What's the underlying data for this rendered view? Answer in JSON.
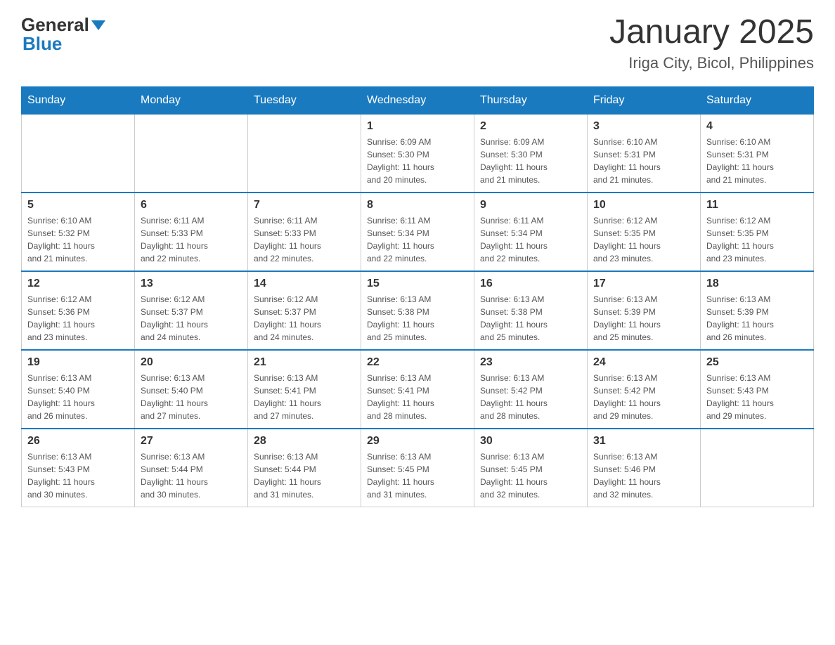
{
  "header": {
    "logo": {
      "general": "General",
      "blue": "Blue"
    },
    "title": "January 2025",
    "location": "Iriga City, Bicol, Philippines"
  },
  "calendar": {
    "days_of_week": [
      "Sunday",
      "Monday",
      "Tuesday",
      "Wednesday",
      "Thursday",
      "Friday",
      "Saturday"
    ],
    "weeks": [
      [
        {
          "day": "",
          "info": ""
        },
        {
          "day": "",
          "info": ""
        },
        {
          "day": "",
          "info": ""
        },
        {
          "day": "1",
          "info": "Sunrise: 6:09 AM\nSunset: 5:30 PM\nDaylight: 11 hours\nand 20 minutes."
        },
        {
          "day": "2",
          "info": "Sunrise: 6:09 AM\nSunset: 5:30 PM\nDaylight: 11 hours\nand 21 minutes."
        },
        {
          "day": "3",
          "info": "Sunrise: 6:10 AM\nSunset: 5:31 PM\nDaylight: 11 hours\nand 21 minutes."
        },
        {
          "day": "4",
          "info": "Sunrise: 6:10 AM\nSunset: 5:31 PM\nDaylight: 11 hours\nand 21 minutes."
        }
      ],
      [
        {
          "day": "5",
          "info": "Sunrise: 6:10 AM\nSunset: 5:32 PM\nDaylight: 11 hours\nand 21 minutes."
        },
        {
          "day": "6",
          "info": "Sunrise: 6:11 AM\nSunset: 5:33 PM\nDaylight: 11 hours\nand 22 minutes."
        },
        {
          "day": "7",
          "info": "Sunrise: 6:11 AM\nSunset: 5:33 PM\nDaylight: 11 hours\nand 22 minutes."
        },
        {
          "day": "8",
          "info": "Sunrise: 6:11 AM\nSunset: 5:34 PM\nDaylight: 11 hours\nand 22 minutes."
        },
        {
          "day": "9",
          "info": "Sunrise: 6:11 AM\nSunset: 5:34 PM\nDaylight: 11 hours\nand 22 minutes."
        },
        {
          "day": "10",
          "info": "Sunrise: 6:12 AM\nSunset: 5:35 PM\nDaylight: 11 hours\nand 23 minutes."
        },
        {
          "day": "11",
          "info": "Sunrise: 6:12 AM\nSunset: 5:35 PM\nDaylight: 11 hours\nand 23 minutes."
        }
      ],
      [
        {
          "day": "12",
          "info": "Sunrise: 6:12 AM\nSunset: 5:36 PM\nDaylight: 11 hours\nand 23 minutes."
        },
        {
          "day": "13",
          "info": "Sunrise: 6:12 AM\nSunset: 5:37 PM\nDaylight: 11 hours\nand 24 minutes."
        },
        {
          "day": "14",
          "info": "Sunrise: 6:12 AM\nSunset: 5:37 PM\nDaylight: 11 hours\nand 24 minutes."
        },
        {
          "day": "15",
          "info": "Sunrise: 6:13 AM\nSunset: 5:38 PM\nDaylight: 11 hours\nand 25 minutes."
        },
        {
          "day": "16",
          "info": "Sunrise: 6:13 AM\nSunset: 5:38 PM\nDaylight: 11 hours\nand 25 minutes."
        },
        {
          "day": "17",
          "info": "Sunrise: 6:13 AM\nSunset: 5:39 PM\nDaylight: 11 hours\nand 25 minutes."
        },
        {
          "day": "18",
          "info": "Sunrise: 6:13 AM\nSunset: 5:39 PM\nDaylight: 11 hours\nand 26 minutes."
        }
      ],
      [
        {
          "day": "19",
          "info": "Sunrise: 6:13 AM\nSunset: 5:40 PM\nDaylight: 11 hours\nand 26 minutes."
        },
        {
          "day": "20",
          "info": "Sunrise: 6:13 AM\nSunset: 5:40 PM\nDaylight: 11 hours\nand 27 minutes."
        },
        {
          "day": "21",
          "info": "Sunrise: 6:13 AM\nSunset: 5:41 PM\nDaylight: 11 hours\nand 27 minutes."
        },
        {
          "day": "22",
          "info": "Sunrise: 6:13 AM\nSunset: 5:41 PM\nDaylight: 11 hours\nand 28 minutes."
        },
        {
          "day": "23",
          "info": "Sunrise: 6:13 AM\nSunset: 5:42 PM\nDaylight: 11 hours\nand 28 minutes."
        },
        {
          "day": "24",
          "info": "Sunrise: 6:13 AM\nSunset: 5:42 PM\nDaylight: 11 hours\nand 29 minutes."
        },
        {
          "day": "25",
          "info": "Sunrise: 6:13 AM\nSunset: 5:43 PM\nDaylight: 11 hours\nand 29 minutes."
        }
      ],
      [
        {
          "day": "26",
          "info": "Sunrise: 6:13 AM\nSunset: 5:43 PM\nDaylight: 11 hours\nand 30 minutes."
        },
        {
          "day": "27",
          "info": "Sunrise: 6:13 AM\nSunset: 5:44 PM\nDaylight: 11 hours\nand 30 minutes."
        },
        {
          "day": "28",
          "info": "Sunrise: 6:13 AM\nSunset: 5:44 PM\nDaylight: 11 hours\nand 31 minutes."
        },
        {
          "day": "29",
          "info": "Sunrise: 6:13 AM\nSunset: 5:45 PM\nDaylight: 11 hours\nand 31 minutes."
        },
        {
          "day": "30",
          "info": "Sunrise: 6:13 AM\nSunset: 5:45 PM\nDaylight: 11 hours\nand 32 minutes."
        },
        {
          "day": "31",
          "info": "Sunrise: 6:13 AM\nSunset: 5:46 PM\nDaylight: 11 hours\nand 32 minutes."
        },
        {
          "day": "",
          "info": ""
        }
      ]
    ]
  }
}
